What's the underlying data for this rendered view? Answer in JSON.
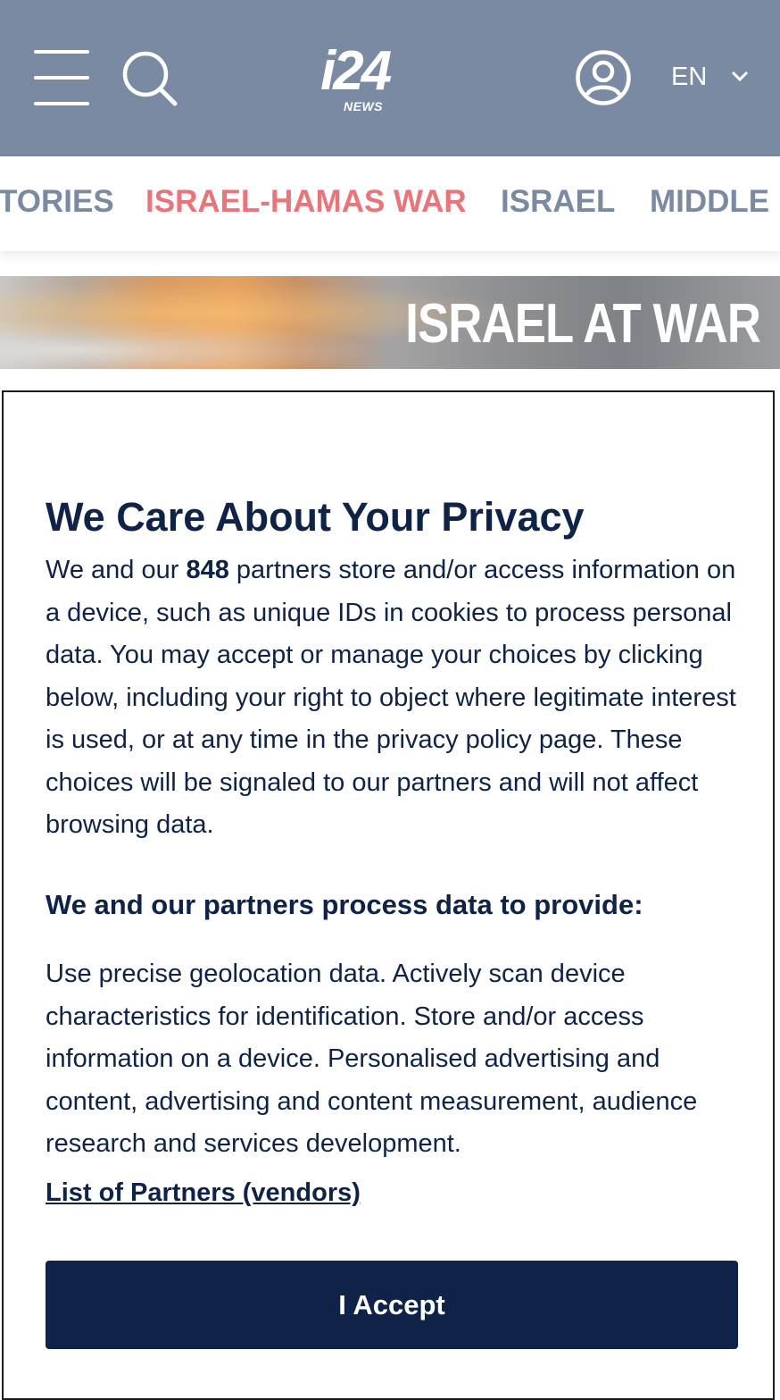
{
  "header": {
    "logo_main": "i24",
    "logo_sub": "NEWS",
    "language": "EN"
  },
  "nav": {
    "items": [
      {
        "label": "TORIES"
      },
      {
        "label": "ISRAEL-HAMAS WAR"
      },
      {
        "label": "ISRAEL"
      },
      {
        "label": "MIDDLE"
      }
    ]
  },
  "banner": {
    "title": "ISRAEL AT WAR"
  },
  "consent": {
    "title": "We Care About Your Privacy",
    "body_prefix": "We and our ",
    "partner_count": "848",
    "body_suffix": " partners store and/or access information on a device, such as unique IDs in cookies to process personal data. You may accept or manage your choices by clicking below, including your right to object where legitimate interest is used, or at any time in the privacy policy page. These choices will be signaled to our partners and will not affect browsing data.",
    "subheading": "We and our partners process data to provide:",
    "purposes": "Use precise geolocation data. Actively scan device characteristics for identification. Store and/or access information on a device. Personalised advertising and content, advertising and content measurement, audience research and services development.",
    "partners_link": "List of Partners (vendors)",
    "accept_label": "I Accept"
  },
  "colors": {
    "header_bg": "#7a8aa3",
    "nav_active": "#e9757a",
    "nav_text": "#7a8aa3",
    "dialog_text": "#0e2347",
    "accept_bg": "#0e2347"
  },
  "icons": [
    "hamburger-menu-icon",
    "search-icon",
    "account-icon",
    "chevron-down-icon"
  ]
}
